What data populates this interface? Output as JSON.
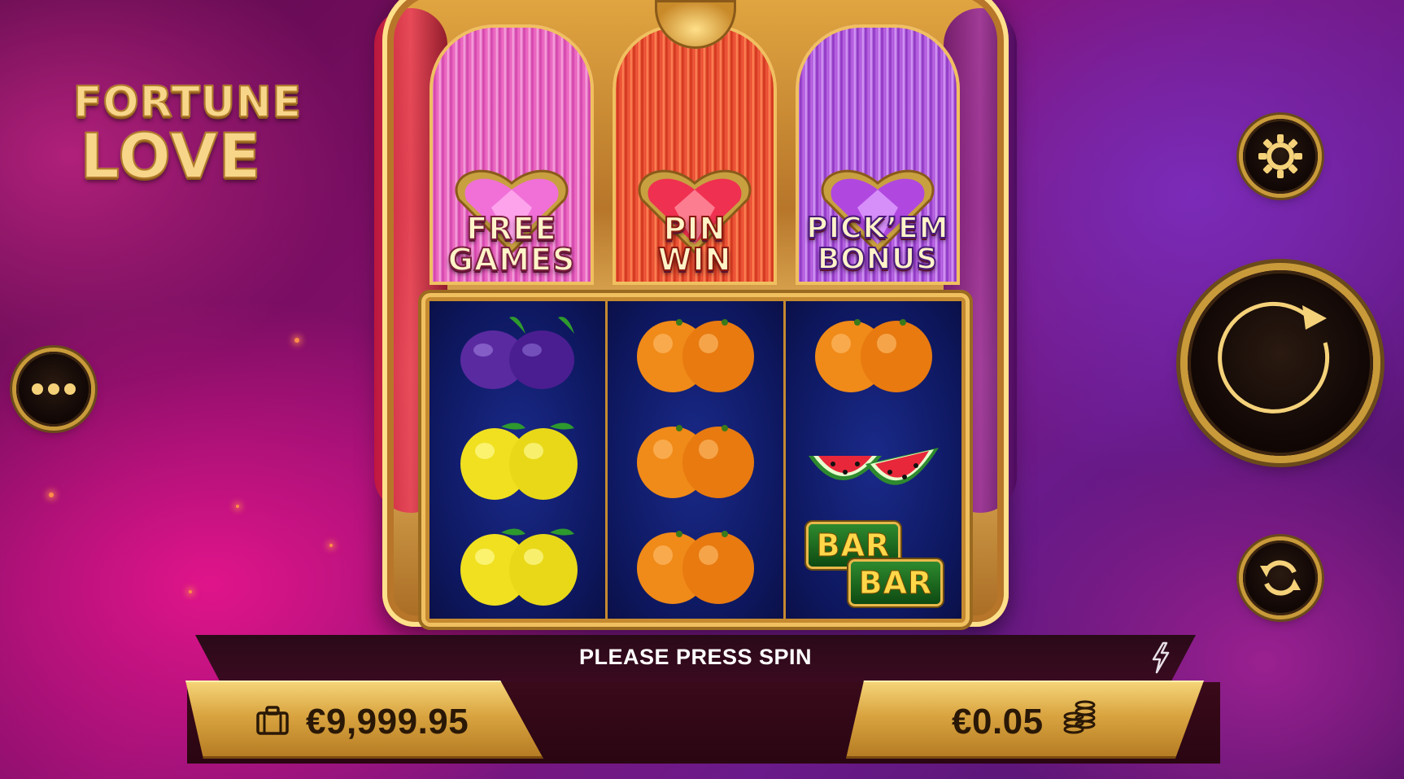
{
  "game": {
    "logo_line1": "FORTUNE",
    "logo_line2": "LOVE"
  },
  "features": [
    {
      "line1": "FREE",
      "line2": "GAMES",
      "color": "#e858b8",
      "gem_color": "#f070d8"
    },
    {
      "line1": "PIN",
      "line2": "WIN",
      "color": "#e8402a",
      "gem_color": "#f03050"
    },
    {
      "line1": "PICK’EM",
      "line2": "BONUS",
      "color": "#a848d8",
      "gem_color": "#b048e0"
    }
  ],
  "reels": [
    [
      "plum",
      "lemon",
      "lemon"
    ],
    [
      "orange",
      "orange",
      "orange"
    ],
    [
      "orange",
      "watermelon",
      "bar"
    ]
  ],
  "symbols": {
    "bar_label": "BAR"
  },
  "message": "PLEASE PRESS SPIN",
  "balance": "€9,999.95",
  "bet": "€0.05",
  "controls": {
    "settings_icon": "gear-icon",
    "menu_icon": "more-dots-icon",
    "spin_icon": "spin-arrow-icon",
    "autoplay_icon": "autoplay-icon",
    "turbo_icon": "lightning-icon"
  },
  "colors": {
    "gold": "#d9a440",
    "reel_bg": "#0e1860",
    "background_pink": "#e0148a",
    "background_purple": "#7a2bb8"
  }
}
